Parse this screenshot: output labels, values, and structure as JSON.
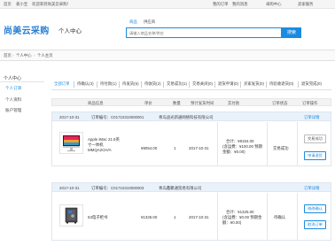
{
  "topbar": {
    "home": "首页",
    "login": "登录",
    "user": "姜小宝",
    "welcome": "欢迎来到尚美云采购！",
    "my_orders": "我的订单",
    "messages": "我的消息",
    "buyer_center": "采购中心",
    "supplier_service": "卖家服务"
  },
  "header": {
    "brand": "尚美云采购",
    "section": "个人中心",
    "search_tabs": [
      "商品",
      "供应商"
    ],
    "search_placeholder": "请输入商品名称/供应",
    "search_button": "搜索"
  },
  "nav": {
    "items": [
      "首页",
      "个人中心",
      "个人主页"
    ]
  },
  "sidebar": {
    "title": "个人中心",
    "items": [
      {
        "label": "个人订单",
        "active": true
      },
      {
        "label": "个人资料",
        "active": false
      },
      {
        "label": "账户管理",
        "active": false
      }
    ]
  },
  "tabs": [
    {
      "label": "全部订单",
      "active": true
    },
    {
      "label": "待确认(3)"
    },
    {
      "label": "待付款(1)"
    },
    {
      "label": "待发货(5)"
    },
    {
      "label": "待收货(2)"
    },
    {
      "label": "交易成功(1)"
    },
    {
      "label": "交易关闭(0)"
    },
    {
      "label": "退货申请(0)"
    },
    {
      "label": "买家发货(0)"
    },
    {
      "label": "待验收退货(0)"
    },
    {
      "label": "退货完成(0)"
    }
  ],
  "table_headers": [
    "商品信息",
    "单价",
    "数量",
    "预计发货时间",
    "实付款",
    "订单状态",
    "订单操作"
  ],
  "orders": [
    {
      "date": "2017-10-31",
      "order_no": "订单编号：C01710310000001",
      "supplier": "青岛迪光新通网络科技有限公司",
      "detail": "订单详情",
      "product_name": "Apple iMac 21.5英寸一体机MMQA2CH/A",
      "price": "¥9054.00",
      "qty": "1",
      "ship_date": "2017-10-31",
      "total": "合计：¥9154.00",
      "fee": "(含运费：¥100.00 预期金额：¥0.00)",
      "status": "交易成功",
      "actions": [
        "交易成功",
        "申请退货"
      ]
    },
    {
      "date": "2017-10-31",
      "order_no": "订单编号：C01710310000003",
      "supplier": "青岛鑫聚通贸易有限公司",
      "detail": "订单详情",
      "product_name": "53电子柜书",
      "price": "¥1325.00",
      "qty": "1",
      "ship_date": "2017-10-31",
      "total": "合计：¥1325.00",
      "fee": "(含运费：¥0.00 预期金额：¥0.00)",
      "status": "待确认",
      "actions": [
        "修改确认",
        "取消订单"
      ]
    }
  ],
  "colors": {
    "accent": "#1a8be0",
    "brand": "#2a7fd4"
  }
}
